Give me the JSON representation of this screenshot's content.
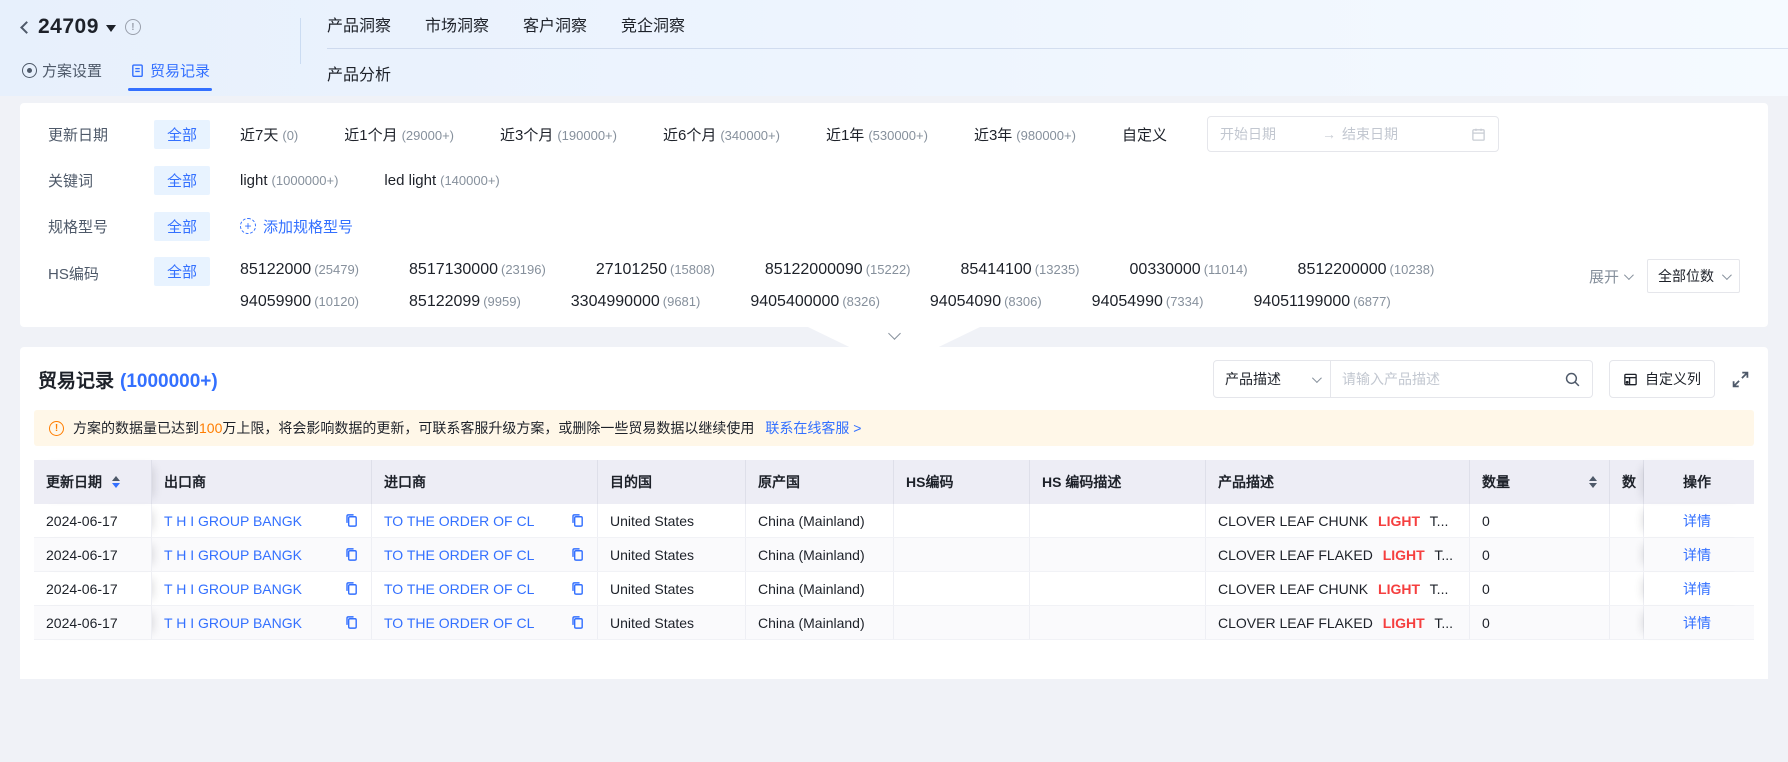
{
  "colors": {
    "primary": "#3370FF",
    "highlight_red": "#F53F3F",
    "warn_orange": "#FF7D00",
    "chip_bg": "#E8F3FF",
    "table_header_bg": "#EDEDF5",
    "notice_bg": "#FFF7E8"
  },
  "icons": {
    "arrow_right": "→",
    "info_mark": "!",
    "warn_mark": "!",
    "plus_mark": "+"
  },
  "topbar": {
    "plan_id": "24709",
    "plan_tabs": [
      {
        "label": "方案设置"
      },
      {
        "label": "贸易记录"
      }
    ],
    "nav_tabs": [
      "产品洞察",
      "市场洞察",
      "客户洞察",
      "竞企洞察"
    ],
    "sub_tab": "产品分析"
  },
  "filters": {
    "update_date": {
      "label": "更新日期",
      "all": "全部",
      "options": [
        {
          "text": "近7天",
          "count": "(0)"
        },
        {
          "text": "近1个月",
          "count": "(29000+)"
        },
        {
          "text": "近3个月",
          "count": "(190000+)"
        },
        {
          "text": "近6个月",
          "count": "(340000+)"
        },
        {
          "text": "近1年",
          "count": "(530000+)"
        },
        {
          "text": "近3年",
          "count": "(980000+)"
        }
      ],
      "custom": "自定义",
      "start_placeholder": "开始日期",
      "end_placeholder": "结束日期"
    },
    "keyword": {
      "label": "关键词",
      "all": "全部",
      "options": [
        {
          "text": "light",
          "count": "(1000000+)"
        },
        {
          "text": "led light",
          "count": "(140000+)"
        }
      ]
    },
    "spec": {
      "label": "规格型号",
      "all": "全部",
      "add_label": "添加规格型号"
    },
    "hs_code": {
      "label": "HS编码",
      "all": "全部",
      "line1": [
        {
          "code": "85122000",
          "count": "(25479)"
        },
        {
          "code": "8517130000",
          "count": "(23196)"
        },
        {
          "code": "27101250",
          "count": "(15808)"
        },
        {
          "code": "85122000090",
          "count": "(15222)"
        },
        {
          "code": "85414100",
          "count": "(13235)"
        },
        {
          "code": "00330000",
          "count": "(11014)"
        },
        {
          "code": "8512200000",
          "count": "(10238)"
        }
      ],
      "line2": [
        {
          "code": "94059900",
          "count": "(10120)"
        },
        {
          "code": "85122099",
          "count": "(9959)"
        },
        {
          "code": "3304990000",
          "count": "(9681)"
        },
        {
          "code": "9405400000",
          "count": "(8326)"
        },
        {
          "code": "94054090",
          "count": "(8306)"
        },
        {
          "code": "94054990",
          "count": "(7334)"
        },
        {
          "code": "94051199000",
          "count": "(6877)"
        }
      ],
      "expand_label": "展开",
      "digits_label": "全部位数"
    }
  },
  "records": {
    "title": "贸易记录",
    "count": "(1000000+)",
    "search_field": "产品描述",
    "search_placeholder": "请输入产品描述",
    "custom_columns_label": "自定义列",
    "notice": {
      "pre": "方案的数据量已达到",
      "highlight": "100",
      "post": "万上限，将会影响数据的更新，可联系客服升级方案，或删除一些贸易数据以继续使用",
      "link": "联系在线客服 >"
    },
    "table": {
      "columns": [
        "更新日期",
        "出口商",
        "进口商",
        "目的国",
        "原产国",
        "HS编码",
        "HS 编码描述",
        "产品描述",
        "数量",
        "数",
        "操作"
      ],
      "rows": [
        {
          "date": "2024-06-17",
          "exporter": "T H I GROUP BANGK",
          "importer": "TO THE ORDER OF CL",
          "dest": "United States",
          "origin": "China (Mainland)",
          "product_pre": "CLOVER LEAF CHUNK ",
          "product_hl": "LIGHT",
          "product_post": " T...",
          "qty": "0",
          "action": "详情"
        },
        {
          "date": "2024-06-17",
          "exporter": "T H I GROUP BANGK",
          "importer": "TO THE ORDER OF CL",
          "dest": "United States",
          "origin": "China (Mainland)",
          "product_pre": "CLOVER LEAF FLAKED ",
          "product_hl": "LIGHT",
          "product_post": " T...",
          "qty": "0",
          "action": "详情"
        },
        {
          "date": "2024-06-17",
          "exporter": "T H I GROUP BANGK",
          "importer": "TO THE ORDER OF CL",
          "dest": "United States",
          "origin": "China (Mainland)",
          "product_pre": "CLOVER LEAF CHUNK ",
          "product_hl": "LIGHT",
          "product_post": " T...",
          "qty": "0",
          "action": "详情"
        },
        {
          "date": "2024-06-17",
          "exporter": "T H I GROUP BANGK",
          "importer": "TO THE ORDER OF CL",
          "dest": "United States",
          "origin": "China (Mainland)",
          "product_pre": "CLOVER LEAF FLAKED ",
          "product_hl": "LIGHT",
          "product_post": " T...",
          "qty": "0",
          "action": "详情"
        }
      ]
    }
  }
}
